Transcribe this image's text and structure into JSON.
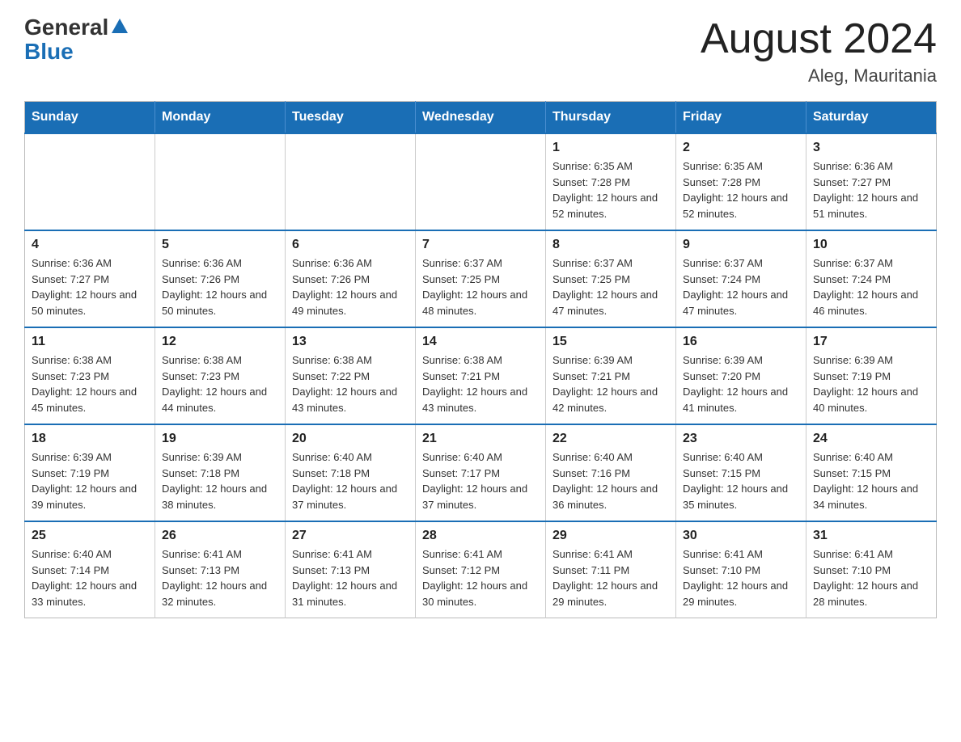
{
  "header": {
    "logo_general": "General",
    "logo_blue": "Blue",
    "month_title": "August 2024",
    "location": "Aleg, Mauritania"
  },
  "days_of_week": [
    "Sunday",
    "Monday",
    "Tuesday",
    "Wednesday",
    "Thursday",
    "Friday",
    "Saturday"
  ],
  "weeks": [
    [
      {
        "day": "",
        "info": ""
      },
      {
        "day": "",
        "info": ""
      },
      {
        "day": "",
        "info": ""
      },
      {
        "day": "",
        "info": ""
      },
      {
        "day": "1",
        "info": "Sunrise: 6:35 AM\nSunset: 7:28 PM\nDaylight: 12 hours and 52 minutes."
      },
      {
        "day": "2",
        "info": "Sunrise: 6:35 AM\nSunset: 7:28 PM\nDaylight: 12 hours and 52 minutes."
      },
      {
        "day": "3",
        "info": "Sunrise: 6:36 AM\nSunset: 7:27 PM\nDaylight: 12 hours and 51 minutes."
      }
    ],
    [
      {
        "day": "4",
        "info": "Sunrise: 6:36 AM\nSunset: 7:27 PM\nDaylight: 12 hours and 50 minutes."
      },
      {
        "day": "5",
        "info": "Sunrise: 6:36 AM\nSunset: 7:26 PM\nDaylight: 12 hours and 50 minutes."
      },
      {
        "day": "6",
        "info": "Sunrise: 6:36 AM\nSunset: 7:26 PM\nDaylight: 12 hours and 49 minutes."
      },
      {
        "day": "7",
        "info": "Sunrise: 6:37 AM\nSunset: 7:25 PM\nDaylight: 12 hours and 48 minutes."
      },
      {
        "day": "8",
        "info": "Sunrise: 6:37 AM\nSunset: 7:25 PM\nDaylight: 12 hours and 47 minutes."
      },
      {
        "day": "9",
        "info": "Sunrise: 6:37 AM\nSunset: 7:24 PM\nDaylight: 12 hours and 47 minutes."
      },
      {
        "day": "10",
        "info": "Sunrise: 6:37 AM\nSunset: 7:24 PM\nDaylight: 12 hours and 46 minutes."
      }
    ],
    [
      {
        "day": "11",
        "info": "Sunrise: 6:38 AM\nSunset: 7:23 PM\nDaylight: 12 hours and 45 minutes."
      },
      {
        "day": "12",
        "info": "Sunrise: 6:38 AM\nSunset: 7:23 PM\nDaylight: 12 hours and 44 minutes."
      },
      {
        "day": "13",
        "info": "Sunrise: 6:38 AM\nSunset: 7:22 PM\nDaylight: 12 hours and 43 minutes."
      },
      {
        "day": "14",
        "info": "Sunrise: 6:38 AM\nSunset: 7:21 PM\nDaylight: 12 hours and 43 minutes."
      },
      {
        "day": "15",
        "info": "Sunrise: 6:39 AM\nSunset: 7:21 PM\nDaylight: 12 hours and 42 minutes."
      },
      {
        "day": "16",
        "info": "Sunrise: 6:39 AM\nSunset: 7:20 PM\nDaylight: 12 hours and 41 minutes."
      },
      {
        "day": "17",
        "info": "Sunrise: 6:39 AM\nSunset: 7:19 PM\nDaylight: 12 hours and 40 minutes."
      }
    ],
    [
      {
        "day": "18",
        "info": "Sunrise: 6:39 AM\nSunset: 7:19 PM\nDaylight: 12 hours and 39 minutes."
      },
      {
        "day": "19",
        "info": "Sunrise: 6:39 AM\nSunset: 7:18 PM\nDaylight: 12 hours and 38 minutes."
      },
      {
        "day": "20",
        "info": "Sunrise: 6:40 AM\nSunset: 7:18 PM\nDaylight: 12 hours and 37 minutes."
      },
      {
        "day": "21",
        "info": "Sunrise: 6:40 AM\nSunset: 7:17 PM\nDaylight: 12 hours and 37 minutes."
      },
      {
        "day": "22",
        "info": "Sunrise: 6:40 AM\nSunset: 7:16 PM\nDaylight: 12 hours and 36 minutes."
      },
      {
        "day": "23",
        "info": "Sunrise: 6:40 AM\nSunset: 7:15 PM\nDaylight: 12 hours and 35 minutes."
      },
      {
        "day": "24",
        "info": "Sunrise: 6:40 AM\nSunset: 7:15 PM\nDaylight: 12 hours and 34 minutes."
      }
    ],
    [
      {
        "day": "25",
        "info": "Sunrise: 6:40 AM\nSunset: 7:14 PM\nDaylight: 12 hours and 33 minutes."
      },
      {
        "day": "26",
        "info": "Sunrise: 6:41 AM\nSunset: 7:13 PM\nDaylight: 12 hours and 32 minutes."
      },
      {
        "day": "27",
        "info": "Sunrise: 6:41 AM\nSunset: 7:13 PM\nDaylight: 12 hours and 31 minutes."
      },
      {
        "day": "28",
        "info": "Sunrise: 6:41 AM\nSunset: 7:12 PM\nDaylight: 12 hours and 30 minutes."
      },
      {
        "day": "29",
        "info": "Sunrise: 6:41 AM\nSunset: 7:11 PM\nDaylight: 12 hours and 29 minutes."
      },
      {
        "day": "30",
        "info": "Sunrise: 6:41 AM\nSunset: 7:10 PM\nDaylight: 12 hours and 29 minutes."
      },
      {
        "day": "31",
        "info": "Sunrise: 6:41 AM\nSunset: 7:10 PM\nDaylight: 12 hours and 28 minutes."
      }
    ]
  ]
}
